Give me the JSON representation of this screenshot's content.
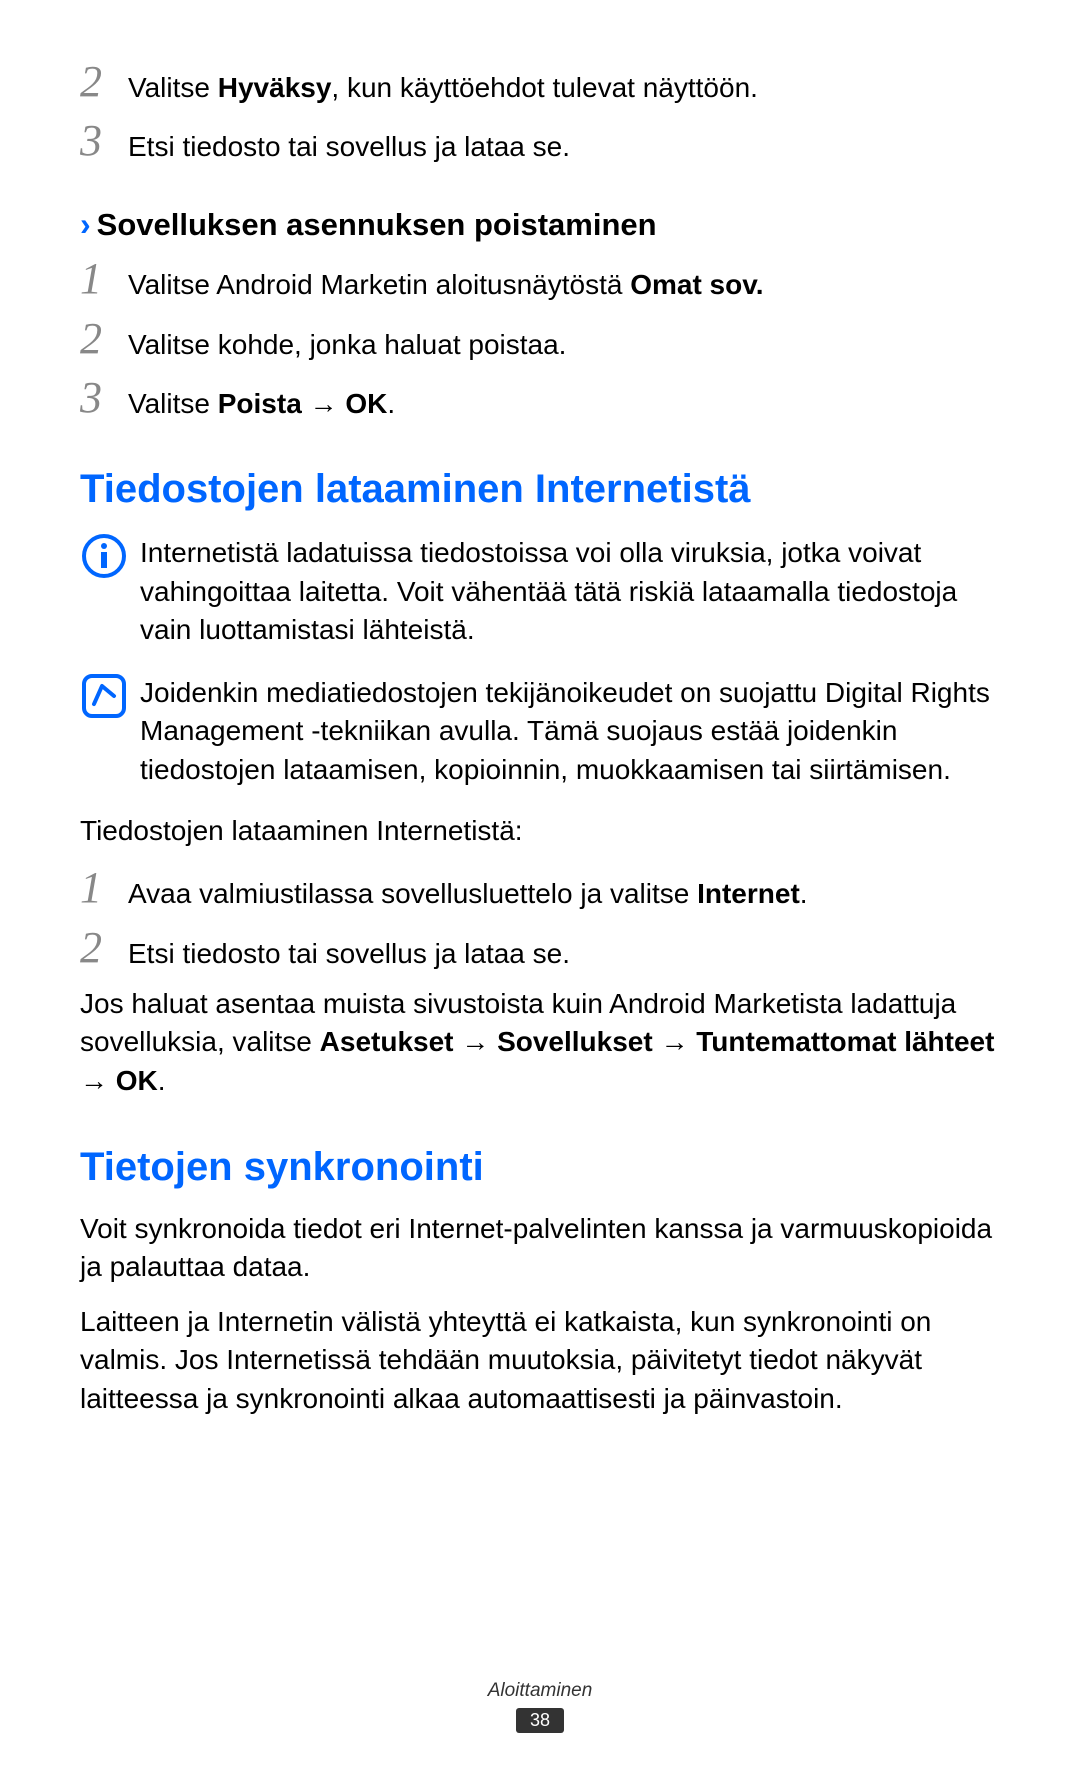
{
  "steps_top": [
    {
      "num": "2",
      "text": "Valitse <b>Hyväksy</b>, kun käyttöehdot tulevat näyttöön."
    },
    {
      "num": "3",
      "text": "Etsi tiedosto tai sovellus ja lataa se."
    }
  ],
  "subheading1": {
    "chevron": "›",
    "text": "Sovelluksen asennuksen poistaminen"
  },
  "steps_uninstall": [
    {
      "num": "1",
      "text": "Valitse Android Marketin aloitusnäytöstä <b>Omat sov.</b>"
    },
    {
      "num": "2",
      "text": "Valitse kohde, jonka haluat poistaa."
    },
    {
      "num": "3",
      "text": "Valitse <b>Poista</b> → <b>OK</b>."
    }
  ],
  "heading1": "Tiedostojen lataaminen Internetistä",
  "note1": "Internetistä ladatuissa tiedostoissa voi olla viruksia, jotka voivat vahingoittaa laitetta. Voit vähentää tätä riskiä lataamalla tiedostoja vain luottamistasi lähteistä.",
  "note2": "Joidenkin mediatiedostojen tekijänoikeudet on suojattu Digital Rights Management -tekniikan avulla. Tämä suojaus estää joidenkin tiedostojen lataamisen, kopioinnin, muokkaamisen tai siirtämisen.",
  "intro_download": "Tiedostojen lataaminen Internetistä:",
  "steps_download": [
    {
      "num": "1",
      "text": "Avaa valmiustilassa sovellusluettelo ja valitse <b>Internet</b>."
    },
    {
      "num": "2",
      "text": "Etsi tiedosto tai sovellus ja lataa se."
    }
  ],
  "install_note": "Jos haluat asentaa muista sivustoista kuin Android Marketista ladattuja sovelluksia, valitse <b>Asetukset</b> → <b>Sovellukset</b> → <b>Tuntemattomat lähteet</b> → <b>OK</b>.",
  "heading2": "Tietojen synkronointi",
  "sync_p1": "Voit synkronoida tiedot eri Internet-palvelinten kanssa ja varmuuskopioida ja palauttaa dataa.",
  "sync_p2": "Laitteen ja Internetin välistä yhteyttä ei katkaista, kun synkronointi on valmis. Jos Internetissä tehdään muutoksia, päivitetyt tiedot näkyvät laitteessa ja synkronointi alkaa automaattisesti ja päinvastoin.",
  "footer_label": "Aloittaminen",
  "page_number": "38"
}
